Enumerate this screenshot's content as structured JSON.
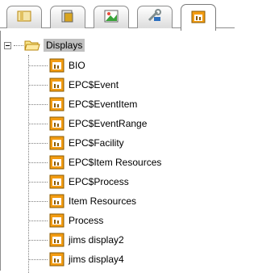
{
  "tabs": [
    {
      "icon": "folder-tab-icon"
    },
    {
      "icon": "document-tab-icon"
    },
    {
      "icon": "image-tab-icon"
    },
    {
      "icon": "tools-tab-icon"
    },
    {
      "icon": "display-tab-icon"
    }
  ],
  "tree": {
    "root_label": "Displays",
    "items": [
      {
        "label": "BIO"
      },
      {
        "label": "EPC$Event"
      },
      {
        "label": "EPC$EventItem"
      },
      {
        "label": "EPC$EventRange"
      },
      {
        "label": "EPC$Facility"
      },
      {
        "label": "EPC$Item Resources"
      },
      {
        "label": "EPC$Process"
      },
      {
        "label": "Item Resources"
      },
      {
        "label": "Process"
      },
      {
        "label": "jims display2"
      },
      {
        "label": "jims display4"
      }
    ]
  },
  "colors": {
    "selection_bg": "#c0c0c0",
    "folder_yellow": "#f5d76e",
    "display_icon_orange": "#f39c12"
  }
}
